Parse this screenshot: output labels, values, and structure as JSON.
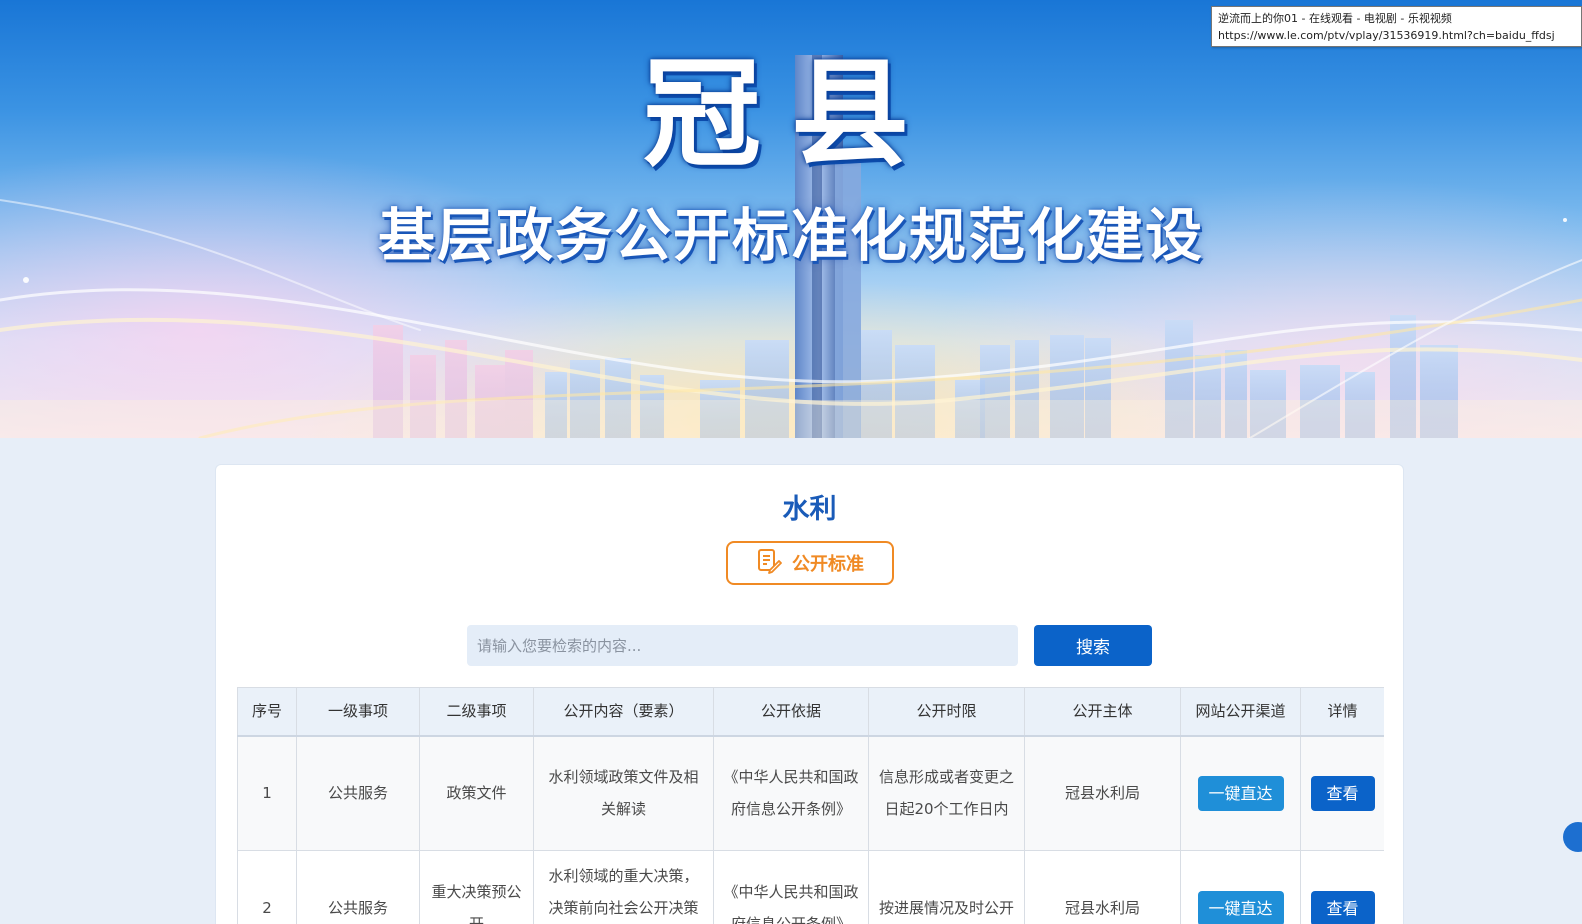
{
  "banner": {
    "title": "冠县",
    "subtitle": "基层政务公开标准化规范化建设"
  },
  "tooltip": {
    "line1": "逆流而上的你01 - 在线观看 - 电视剧 - 乐视视频",
    "line2": "https://www.le.com/ptv/vplay/31536919.html?ch=baidu_ffdsj"
  },
  "section": {
    "title": "水利",
    "standard_button": "公开标准"
  },
  "search": {
    "placeholder": "请输入您要检索的内容...",
    "button": "搜索"
  },
  "table": {
    "headers": [
      "序号",
      "一级事项",
      "二级事项",
      "公开内容（要素）",
      "公开依据",
      "公开时限",
      "公开主体",
      "网站公开渠道",
      "详情"
    ],
    "rows": [
      {
        "index": "1",
        "level1": "公共服务",
        "level2": "政策文件",
        "content": "水利领域政策文件及相关解读",
        "basis": "《中华人民共和国政府信息公开条例》",
        "time_limit": "信息形成或者变更之日起20个工作日内",
        "subject": "冠县水利局",
        "channel_button": "一键直达",
        "detail_button": "查看"
      },
      {
        "index": "2",
        "level1": "公共服务",
        "level2": "重大决策预公开",
        "content": "水利领域的重大决策，决策前向社会公开决策草案",
        "basis": "《中华人民共和国政府信息公开条例》",
        "time_limit": "按进展情况及时公开",
        "subject": "冠县水利局",
        "channel_button": "一键直达",
        "detail_button": "查看"
      }
    ]
  },
  "colors": {
    "accent_blue": "#0b63c9",
    "title_blue": "#1a5bb8",
    "orange": "#f08a24",
    "page_bg": "#e7eef8"
  },
  "icons": {
    "standard_button_icon": "document-edit-icon"
  }
}
